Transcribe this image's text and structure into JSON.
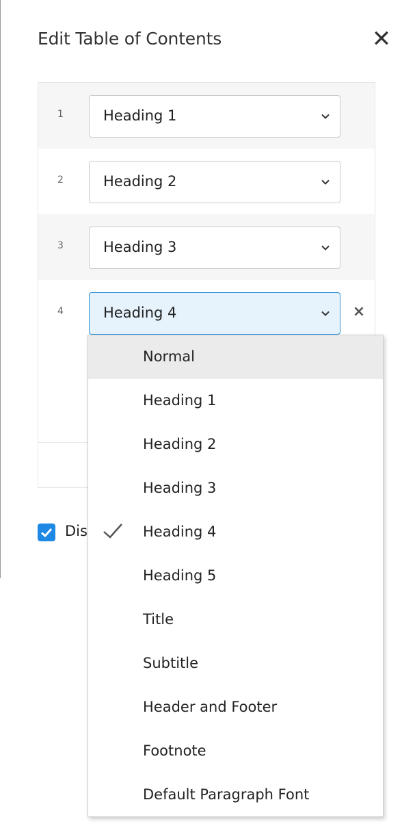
{
  "dialog": {
    "title": "Edit Table of Contents",
    "close_glyph": "✕",
    "levels": [
      {
        "number": "1",
        "style": "Heading 1"
      },
      {
        "number": "2",
        "style": "Heading 2"
      },
      {
        "number": "3",
        "style": "Heading 3"
      },
      {
        "number": "4",
        "style": "Heading 4"
      }
    ],
    "remove_glyph": "×",
    "display_checkbox": {
      "checked": true,
      "label_visible": "Dis"
    }
  },
  "dropdown": {
    "options": [
      "Normal",
      "Heading 1",
      "Heading 2",
      "Heading 3",
      "Heading 4",
      "Heading 5",
      "Title",
      "Subtitle",
      "Header and Footer",
      "Footnote",
      "Default Paragraph Font"
    ],
    "selected": "Heading 4",
    "hovered": "Normal"
  },
  "colors": {
    "accent": "#1e88e5",
    "active_select_bg": "#e6f3fc",
    "active_select_border": "#2c8fd6",
    "hover_bg": "#ebebeb"
  },
  "icons": {
    "close": "close-icon",
    "chevron": "chevron-down-icon",
    "check": "checkmark-icon",
    "remove": "remove-icon"
  }
}
